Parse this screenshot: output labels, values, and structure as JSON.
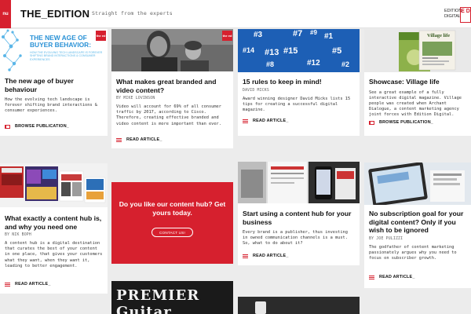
{
  "header": {
    "menu_label": "nu",
    "logo": "THE_EDITION",
    "tagline": "Straight from the experts",
    "brand_text_1": "EDITION",
    "brand_text_2": "DIGITAL",
    "brand_mark": "E D"
  },
  "cards": [
    {
      "title": "The new age of buyer behaviour",
      "byline": "",
      "excerpt": "How the evolving tech landscape is forever shifting brand interactions & consumer experiences.",
      "cta": "BROWSE PUBLICATION_",
      "thumb_heading": "THE NEW AGE OF BUYER BEHAVIOR:",
      "thumb_sub": "HOW THE EVOLVING TECH LANDSCAPE IS FOREVER SHIFTING BRAND INTERACTIONS & CONSUMER EXPERIENCES",
      "thumb_badge": "the ed"
    },
    {
      "title": "What makes great branded and video content?",
      "byline": "BY MIKE LOVINSON",
      "excerpt": "Video will account for 69% of all consumer traffic by 2017, according to Cisco. Therefore, creating effective branded and video content is more important than ever.",
      "cta": "READ ARTICLE_",
      "thumb_badge": "the ed"
    },
    {
      "title": "15 rules to keep in mind!",
      "byline": "DAVID MICKS",
      "excerpt": "Award winning designer David Micks lists 15 tips for creating a successful digital magazine.",
      "cta": "READ ARTICLE_",
      "thumb_numbers": [
        "#3",
        "#7",
        "#1",
        "#9",
        "#14",
        "#13",
        "#15",
        "#5",
        "#8",
        "#12",
        "#2"
      ]
    },
    {
      "title": "Showcase: Village life",
      "byline": "",
      "excerpt": "See a great example of a fully interactive digital magazine. Village people was created when Archant Dialogue, a content marketing agency joint forces with Edition Digital.",
      "cta": "BROWSE PUBLICATION_",
      "thumb_heading": "Village life"
    },
    {
      "title": "What exactly a content hub is, and why you need one",
      "byline": "BY NIK BOPH",
      "excerpt": "A content hub is a digital destination that curates the best of your content in one place, that gives your customers what they want, when they want it, leading to better engagement.",
      "cta": "READ ARTICLE_"
    },
    {
      "title": "Start using a content hub for your business",
      "byline": "",
      "excerpt": "Every brand is a publisher, thus investing in owned communication channels is a must. So, what to do about it?",
      "cta": "READ ARTICLE_"
    },
    {
      "title": "No subscription goal for your digital content? Only if you wish to be ignored",
      "byline": "BY JOE PULIZZI",
      "excerpt": "The godfather of content marketing passionately argues why you need to focus on subscriber growth.",
      "cta": "READ ARTICLE_"
    }
  ],
  "promo": {
    "title": "Do you like our content hub? Get yours today.",
    "button": "CONTACT US!"
  },
  "bottom_thumb_text": "PREMIER Guitar",
  "colors": {
    "accent": "#d6202e",
    "blue": "#1d5fb5",
    "background": "#ececec"
  }
}
